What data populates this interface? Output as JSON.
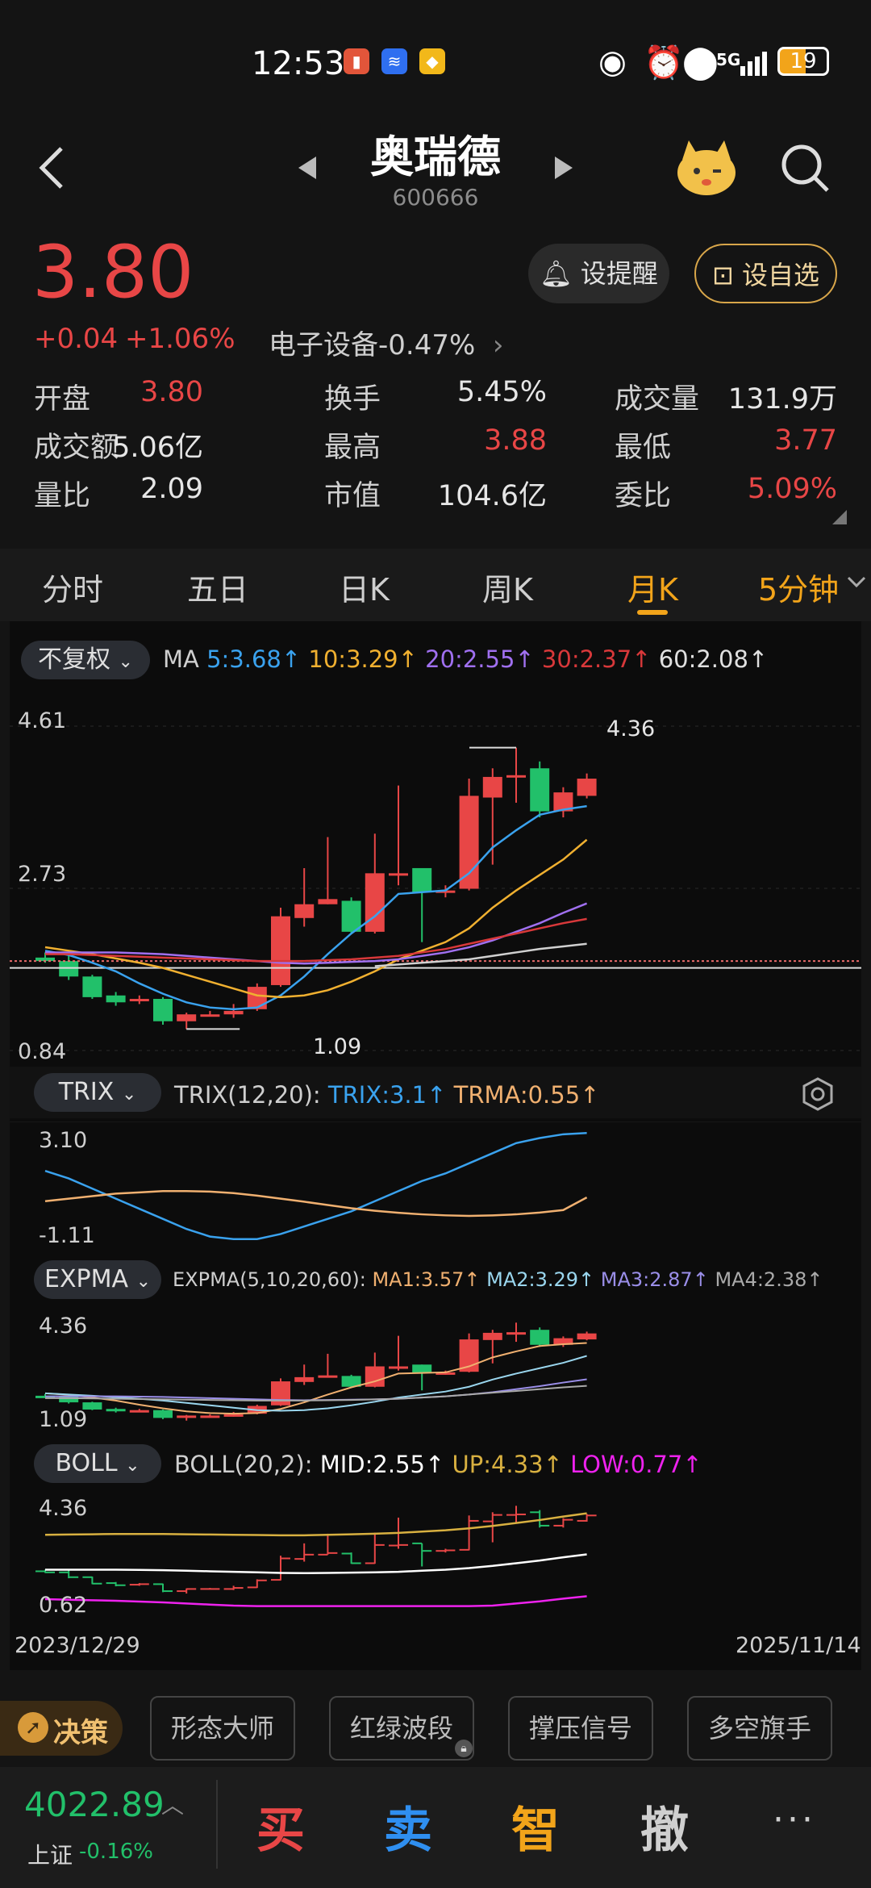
{
  "status_bar": {
    "time": "12:53",
    "battery": "19",
    "network": "5G"
  },
  "header": {
    "name": "奥瑞德",
    "code": "600666"
  },
  "quote": {
    "price": "3.80",
    "change": "+0.04",
    "change_pct": "+1.06%",
    "sector": "电子设备",
    "sector_change": "-0.47%",
    "alert_label": "设提醒",
    "watch_label": "设自选"
  },
  "stats": [
    {
      "label": "开盘",
      "value": "3.80",
      "color": "red"
    },
    {
      "label": "换手",
      "value": "5.45%",
      "color": "white"
    },
    {
      "label": "成交量",
      "value": "131.9万",
      "color": "white"
    },
    {
      "label": "成交额",
      "value": "5.06亿",
      "color": "white"
    },
    {
      "label": "最高",
      "value": "3.88",
      "color": "red"
    },
    {
      "label": "最低",
      "value": "3.77",
      "color": "red"
    },
    {
      "label": "量比",
      "value": "2.09",
      "color": "white"
    },
    {
      "label": "市值",
      "value": "104.6亿",
      "color": "white"
    },
    {
      "label": "委比",
      "value": "5.09%",
      "color": "red"
    }
  ],
  "tabs": [
    "分时",
    "五日",
    "日K",
    "周K",
    "月K",
    "5分钟"
  ],
  "active_tab": "月K",
  "ma_bar": {
    "adjust": "不复权",
    "ma": "MA",
    "ma5": "5:3.68↑",
    "ma10": "10:3.29↑",
    "ma20": "20:2.55↑",
    "ma30": "30:2.37↑",
    "ma60": "60:2.08↑"
  },
  "chart_data": {
    "type": "candlestick",
    "price_axis": {
      "max": "4.61",
      "mid": "2.73",
      "min": "0.84"
    },
    "high_label": "4.36",
    "low_label": "1.09",
    "x_start": "2023/12/29",
    "x_end": "2025/11/14",
    "candles": [
      {
        "o": 1.92,
        "c": 1.88,
        "h": 1.98,
        "l": 1.86
      },
      {
        "o": 1.88,
        "c": 1.7,
        "h": 1.95,
        "l": 1.66
      },
      {
        "o": 1.7,
        "c": 1.46,
        "h": 1.72,
        "l": 1.44
      },
      {
        "o": 1.48,
        "c": 1.4,
        "h": 1.52,
        "l": 1.36
      },
      {
        "o": 1.42,
        "c": 1.44,
        "h": 1.48,
        "l": 1.38
      },
      {
        "o": 1.44,
        "c": 1.18,
        "h": 1.46,
        "l": 1.14
      },
      {
        "o": 1.18,
        "c": 1.26,
        "h": 1.28,
        "l": 1.09
      },
      {
        "o": 1.26,
        "c": 1.26,
        "h": 1.3,
        "l": 1.24
      },
      {
        "o": 1.26,
        "c": 1.3,
        "h": 1.38,
        "l": 1.22
      },
      {
        "o": 1.32,
        "c": 1.58,
        "h": 1.62,
        "l": 1.3
      },
      {
        "o": 1.6,
        "c": 2.4,
        "h": 2.5,
        "l": 1.58
      },
      {
        "o": 2.38,
        "c": 2.54,
        "h": 2.96,
        "l": 2.28
      },
      {
        "o": 2.54,
        "c": 2.6,
        "h": 3.32,
        "l": 2.54
      },
      {
        "o": 2.58,
        "c": 2.22,
        "h": 2.62,
        "l": 2.2
      },
      {
        "o": 2.22,
        "c": 2.9,
        "h": 3.36,
        "l": 2.2
      },
      {
        "o": 2.88,
        "c": 2.9,
        "h": 3.92,
        "l": 2.76
      },
      {
        "o": 2.96,
        "c": 2.68,
        "h": 2.96,
        "l": 2.1
      },
      {
        "o": 2.68,
        "c": 2.7,
        "h": 2.76,
        "l": 2.62
      },
      {
        "o": 2.72,
        "c": 3.8,
        "h": 4.0,
        "l": 2.7
      },
      {
        "o": 3.78,
        "c": 4.02,
        "h": 4.12,
        "l": 3.0
      },
      {
        "o": 4.02,
        "c": 4.04,
        "h": 4.36,
        "l": 3.72
      },
      {
        "o": 4.12,
        "c": 3.62,
        "h": 4.2,
        "l": 3.55
      },
      {
        "o": 3.62,
        "c": 3.84,
        "h": 3.9,
        "l": 3.55
      },
      {
        "o": 3.8,
        "c": 4.0,
        "h": 4.06,
        "l": 3.77
      }
    ],
    "ma_lines": [
      {
        "name": "MA5",
        "color": "#3aa2ee",
        "values": [
          2.0,
          1.95,
          1.86,
          1.76,
          1.62,
          1.5,
          1.4,
          1.34,
          1.32,
          1.34,
          1.48,
          1.7,
          1.96,
          2.2,
          2.4,
          2.66,
          2.68,
          2.7,
          2.9,
          3.2,
          3.4,
          3.58,
          3.64,
          3.68
        ]
      },
      {
        "name": "MA10",
        "color": "#f0b030",
        "values": [
          2.04,
          2.0,
          1.96,
          1.91,
          1.86,
          1.8,
          1.72,
          1.64,
          1.56,
          1.48,
          1.46,
          1.48,
          1.54,
          1.64,
          1.76,
          1.9,
          2.0,
          2.1,
          2.26,
          2.5,
          2.7,
          2.88,
          3.06,
          3.29
        ]
      },
      {
        "name": "MA20",
        "color": "#a070f0",
        "values": [
          1.98,
          1.98,
          1.98,
          1.98,
          1.97,
          1.96,
          1.94,
          1.92,
          1.9,
          1.88,
          1.86,
          1.85,
          1.86,
          1.87,
          1.88,
          1.9,
          1.94,
          1.98,
          2.04,
          2.12,
          2.22,
          2.32,
          2.44,
          2.55
        ]
      },
      {
        "name": "MA30",
        "color": "#d8383a",
        "values": [
          1.96,
          1.96,
          1.95,
          1.94,
          1.93,
          1.92,
          1.91,
          1.9,
          1.89,
          1.88,
          1.88,
          1.88,
          1.89,
          1.9,
          1.92,
          1.94,
          1.98,
          2.02,
          2.08,
          2.14,
          2.2,
          2.26,
          2.32,
          2.37
        ]
      },
      {
        "name": "MA60",
        "color": "#d0d0d0",
        "values": [
          null,
          null,
          null,
          null,
          null,
          null,
          null,
          null,
          null,
          null,
          null,
          null,
          null,
          null,
          1.82,
          1.84,
          1.86,
          1.88,
          1.9,
          1.94,
          1.98,
          2.02,
          2.05,
          2.08
        ]
      }
    ],
    "ref_lines": [
      1.88,
      1.8
    ]
  },
  "trix": {
    "button": "TRIX",
    "params": "TRIX(12,20):",
    "trix": "TRIX:3.1↑",
    "trma": "TRMA:0.55↑",
    "max": "3.10",
    "min": "-1.11",
    "trix_values": [
      1.6,
      1.3,
      0.9,
      0.5,
      0.1,
      -0.3,
      -0.7,
      -1.0,
      -1.1,
      -1.1,
      -0.9,
      -0.6,
      -0.3,
      0.0,
      0.4,
      0.8,
      1.2,
      1.5,
      1.9,
      2.3,
      2.7,
      2.9,
      3.05,
      3.1
    ],
    "trma_values": [
      0.4,
      0.5,
      0.6,
      0.7,
      0.75,
      0.8,
      0.8,
      0.78,
      0.72,
      0.62,
      0.5,
      0.38,
      0.25,
      0.12,
      0.02,
      -0.06,
      -0.12,
      -0.16,
      -0.18,
      -0.16,
      -0.12,
      -0.05,
      0.05,
      0.55
    ]
  },
  "expma": {
    "button": "EXPMA",
    "params": "EXPMA(5,10,20,60):",
    "ma1": "MA1:3.57↑",
    "ma2": "MA2:3.29↑",
    "ma3": "MA3:2.87↑",
    "ma4": "MA4:2.38↑",
    "max": "4.36",
    "min": "1.09"
  },
  "boll": {
    "button": "BOLL",
    "params": "BOLL(20,2):",
    "mid": "MID:2.55↑",
    "up": "UP:4.33↑",
    "low": "LOW:0.77↑",
    "max": "4.36",
    "min": "0.62"
  },
  "tools": {
    "decision": "决策",
    "items": [
      "形态大师",
      "红绿波段",
      "撑压信号",
      "多空旗手"
    ]
  },
  "bottom": {
    "index_value": "4022.89",
    "index_name": "上证",
    "index_change": "-0.16%",
    "buy": "买",
    "sell": "卖",
    "smart": "智",
    "cancel": "撤",
    "more": "···"
  },
  "colors": {
    "up": "#e84646",
    "down": "#22c06a",
    "accent": "#f2a41a",
    "bg": "#141414"
  }
}
